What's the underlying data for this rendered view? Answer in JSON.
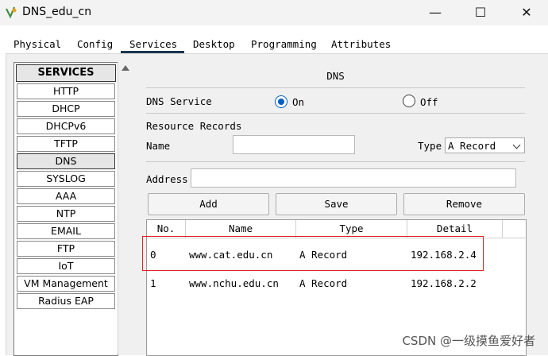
{
  "window": {
    "title": "DNS_edu_cn",
    "minimize": "—",
    "maximize": "☐",
    "close": "✕"
  },
  "tabs": [
    "Physical",
    "Config",
    "Services",
    "Desktop",
    "Programming",
    "Attributes"
  ],
  "services": {
    "header": "SERVICES",
    "items": [
      "HTTP",
      "DHCP",
      "DHCPv6",
      "TFTP",
      "DNS",
      "SYSLOG",
      "AAA",
      "NTP",
      "EMAIL",
      "FTP",
      "IoT",
      "VM Management",
      "Radius EAP"
    ],
    "selected": "DNS"
  },
  "dns": {
    "title": "DNS",
    "service_label": "DNS Service",
    "on_label": "On",
    "off_label": "Off",
    "service_state": "On",
    "resource_records_label": "Resource Records",
    "name_label": "Name",
    "name_value": "",
    "type_label": "Type",
    "type_value": "A Record",
    "address_label": "Address",
    "address_value": ""
  },
  "buttons": {
    "add": "Add",
    "save": "Save",
    "remove": "Remove"
  },
  "table": {
    "headers": [
      "No.",
      "Name",
      "Type",
      "Detail"
    ],
    "rows": [
      {
        "no": "0",
        "name": "www.cat.edu.cn",
        "type": "A Record",
        "detail": "192.168.2.4"
      },
      {
        "no": "1",
        "name": "www.nchu.edu.cn",
        "type": "A Record",
        "detail": "192.168.2.2"
      }
    ]
  },
  "watermark": "CSDN @一级摸鱼爱好者",
  "colors": {
    "accent": "#0060c0",
    "highlight": "#e02020",
    "tab_underline": "#1a3550"
  }
}
